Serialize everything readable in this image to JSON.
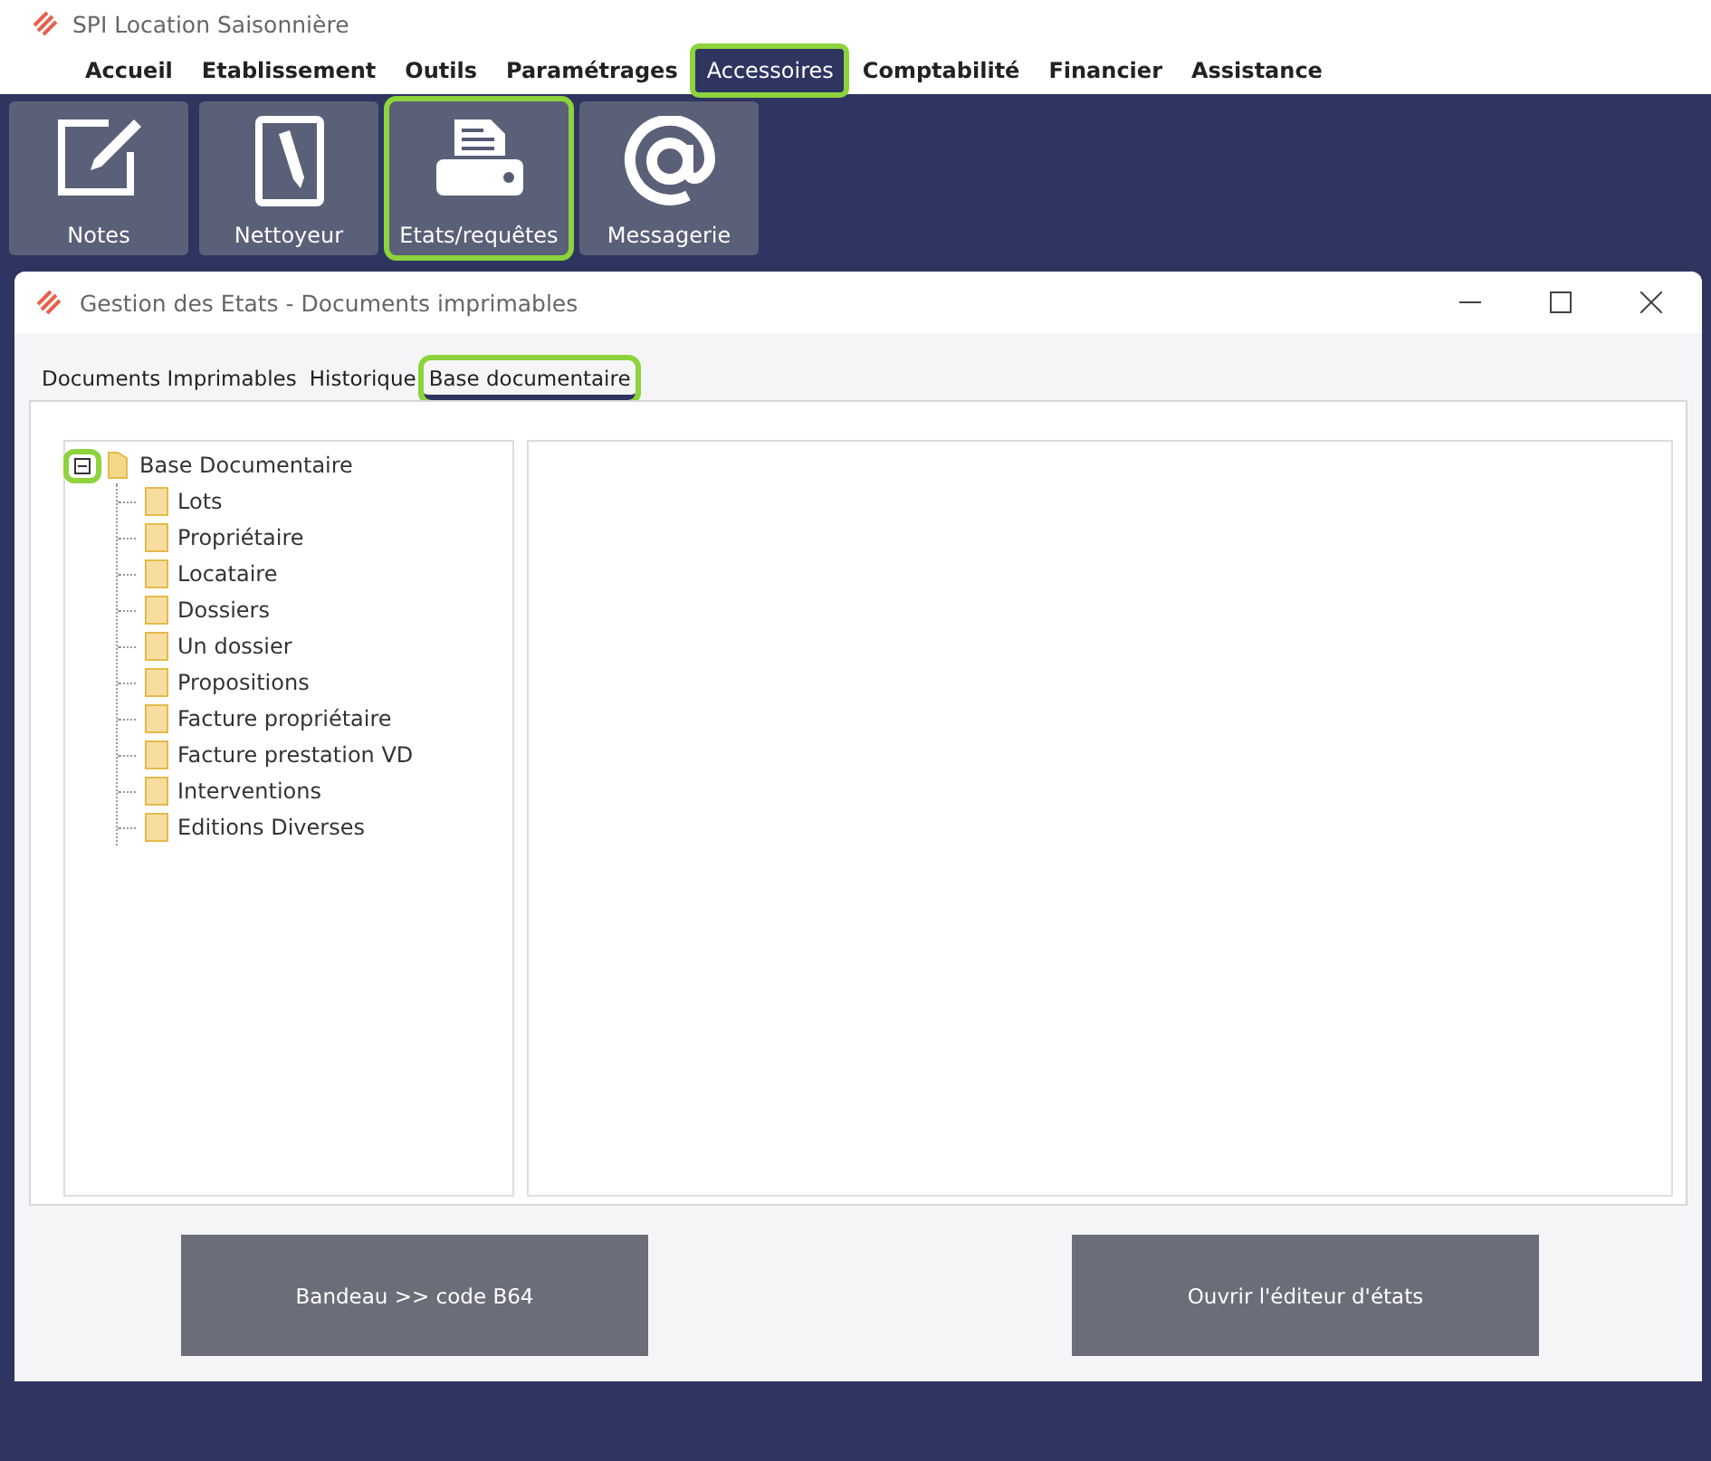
{
  "app": {
    "title": "SPI Location Saisonnière"
  },
  "menu": [
    {
      "label": "Accueil",
      "selected": false,
      "highlighted": false
    },
    {
      "label": "Etablissement",
      "selected": false,
      "highlighted": false
    },
    {
      "label": "Outils",
      "selected": false,
      "highlighted": false
    },
    {
      "label": "Paramétrages",
      "selected": false,
      "highlighted": false
    },
    {
      "label": "Accessoires",
      "selected": true,
      "highlighted": true
    },
    {
      "label": "Comptabilité",
      "selected": false,
      "highlighted": false
    },
    {
      "label": "Financier",
      "selected": false,
      "highlighted": false
    },
    {
      "label": "Assistance",
      "selected": false,
      "highlighted": false
    }
  ],
  "toolbar": [
    {
      "label": "Notes",
      "kind": "note",
      "highlighted": false
    },
    {
      "label": "Nettoyeur",
      "kind": "cleaner",
      "highlighted": false
    },
    {
      "label": "Etats/requêtes",
      "kind": "printer",
      "highlighted": true
    },
    {
      "label": "Messagerie",
      "kind": "mail",
      "highlighted": false
    }
  ],
  "dialog": {
    "title": "Gestion des Etats - Documents imprimables",
    "tabs": [
      {
        "label": "Documents Imprimables",
        "selected": false,
        "highlighted": false
      },
      {
        "label": "Historique",
        "selected": false,
        "highlighted": false
      },
      {
        "label": "Base documentaire",
        "selected": true,
        "highlighted": true
      }
    ],
    "tree": {
      "label": "Base Documentaire",
      "expanded": true,
      "toggle_highlighted": true,
      "children": [
        {
          "label": "Lots"
        },
        {
          "label": "Propriétaire"
        },
        {
          "label": "Locataire"
        },
        {
          "label": "Dossiers"
        },
        {
          "label": "Un dossier"
        },
        {
          "label": "Propositions"
        },
        {
          "label": "Facture propriétaire"
        },
        {
          "label": "Facture prestation VD"
        },
        {
          "label": "Interventions"
        },
        {
          "label": "Editions Diverses"
        }
      ]
    },
    "buttons": [
      "Bandeau >> code B64",
      "Ouvrir l'éditeur d'états"
    ]
  }
}
